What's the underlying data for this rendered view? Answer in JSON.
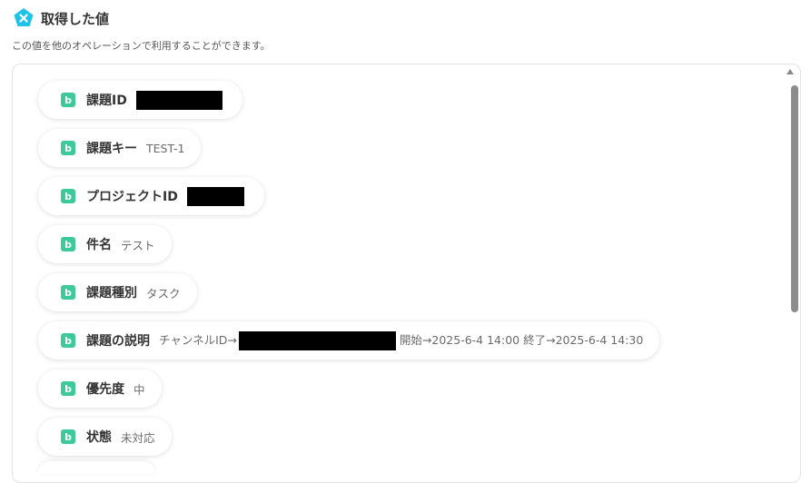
{
  "header": {
    "title": "取得した値",
    "icon": "yoom-logo-icon",
    "icon_color": "#1ec3e8"
  },
  "description": "この値を他のオペレーションで利用することができます。",
  "colors": {
    "chip_icon": "#3ec99a",
    "redaction": "#000000"
  },
  "items": [
    {
      "label": "課題ID",
      "value": ""
    },
    {
      "label": "課題キー",
      "value": "TEST-1"
    },
    {
      "label": "プロジェクトID",
      "value": ""
    },
    {
      "label": "件名",
      "value": "テスト"
    },
    {
      "label": "課題種別",
      "value": "タスク"
    },
    {
      "label": "課題の説明",
      "value_prefix": "チャンネルID→",
      "value_suffix": "開始→2025-6-4 14:00 終了→2025-6-4 14:30"
    },
    {
      "label": "優先度",
      "value": "中"
    },
    {
      "label": "状態",
      "value": "未対応"
    }
  ],
  "chip_icon_glyph": "b"
}
